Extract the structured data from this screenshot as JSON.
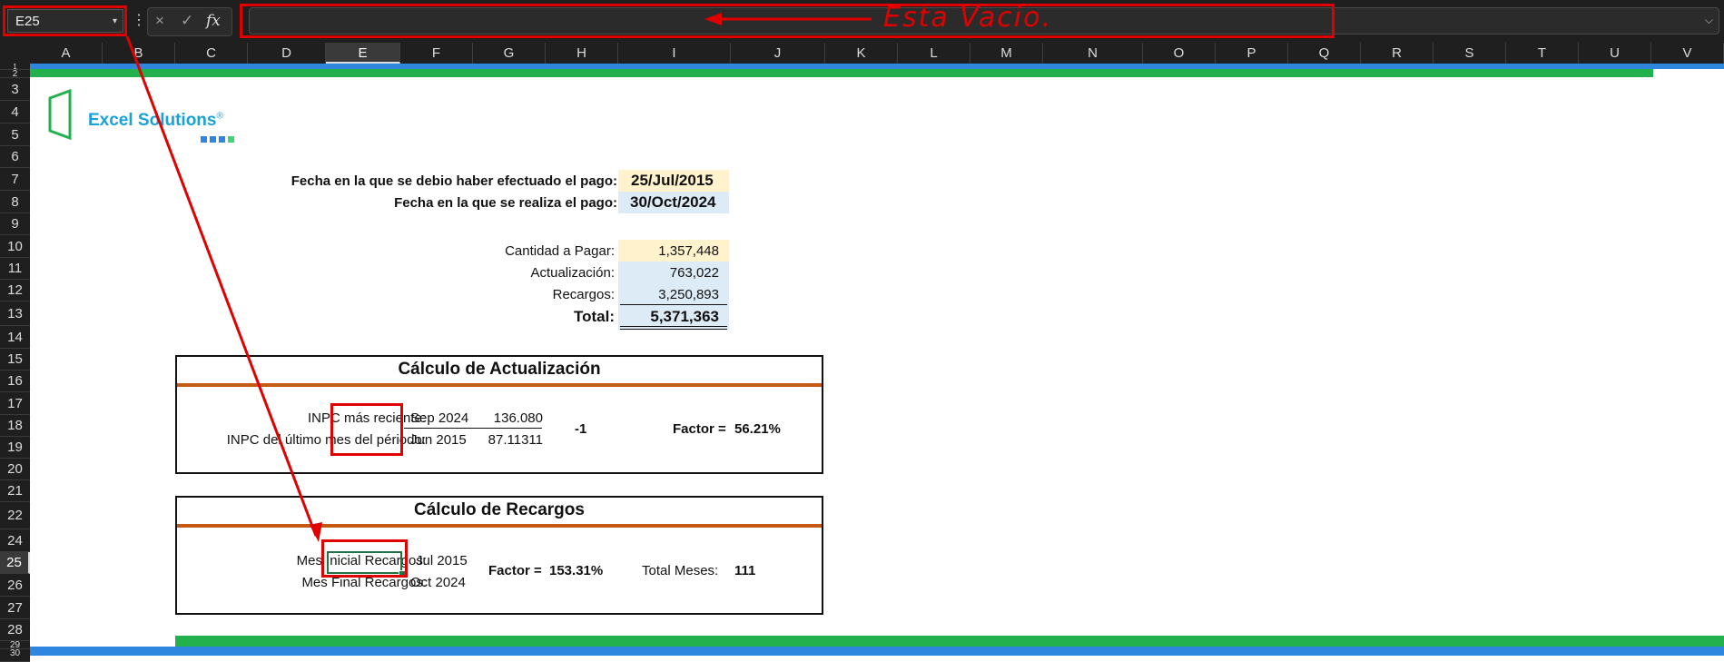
{
  "formula_bar": {
    "name_box": "E25",
    "more_icon": "⋮",
    "cancel_icon": "×",
    "enter_icon": "✓",
    "fx_label": "fx",
    "formula_value": ""
  },
  "annotation": {
    "text": "Esta Vacio."
  },
  "columns": [
    "A",
    "B",
    "C",
    "D",
    "E",
    "F",
    "G",
    "H",
    "I",
    "J",
    "K",
    "L",
    "M",
    "N",
    "O",
    "P",
    "Q",
    "R",
    "S",
    "T",
    "U",
    "V"
  ],
  "rows": [
    "1",
    "2",
    "3",
    "4",
    "5",
    "6",
    "7",
    "8",
    "9",
    "10",
    "11",
    "12",
    "13",
    "14",
    "15",
    "16",
    "17",
    "18",
    "19",
    "20",
    "21",
    "22",
    "24",
    "25",
    "26",
    "27",
    "28",
    "29",
    "30"
  ],
  "selected_cell": "E25",
  "logo": {
    "name": "Excel Solutions",
    "mark": "®"
  },
  "dates": {
    "due_label": "Fecha en la que se debio haber efectuado el pago:",
    "due_value": "25/Jul/2015",
    "paid_label": "Fecha en la que se realiza el pago:",
    "paid_value": "30/Oct/2024"
  },
  "summary": {
    "cantidad_label": "Cantidad a Pagar:",
    "cantidad_value": "1,357,448",
    "actualizacion_label": "Actualización:",
    "actualizacion_value": "763,022",
    "recargos_label": "Recargos:",
    "recargos_value": "3,250,893",
    "total_label": "Total:",
    "total_value": "5,371,363"
  },
  "actualizacion": {
    "title": "Cálculo de Actualización",
    "inpc_reciente_label": "INPC más reciente:",
    "inpc_reciente_month": "Sep 2024",
    "inpc_reciente_value": "136.080",
    "inpc_ultimo_label": "INPC del último mes del périodo:",
    "inpc_ultimo_month": "Jun 2015",
    "inpc_ultimo_value": "87.11311",
    "minus_one": "-1",
    "factor_label": "Factor =",
    "factor_value": "56.21%"
  },
  "recargos": {
    "title": "Cálculo de Recargos",
    "mes_inicial_label": "Mes Inicial Recargos:",
    "mes_inicial_value": "Jul 2015",
    "mes_final_label": "Mes Final Recargos:",
    "mes_final_value": "Oct 2024",
    "factor_label": "Factor =",
    "factor_value": "153.31%",
    "total_meses_label": "Total Meses:",
    "total_meses_value": "111"
  },
  "colors": {
    "green_bar": "#22b14c",
    "blue_bar": "#2e86de",
    "orange_rule": "#c65911",
    "annotation_red": "#e00000",
    "yellow_cell": "#fff2cc",
    "blue_cell": "#ddebf7"
  }
}
